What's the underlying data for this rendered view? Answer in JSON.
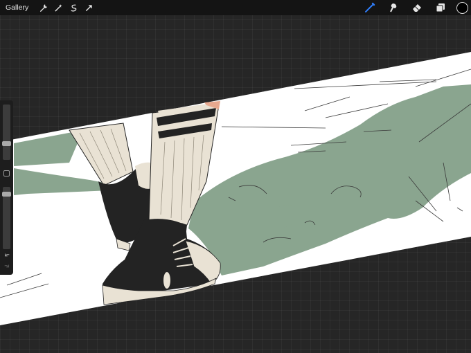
{
  "toolbar": {
    "gallery_label": "Gallery",
    "left_tools": [
      "wrench-icon",
      "magic-wand-icon",
      "selection-icon",
      "transform-arrow-icon"
    ],
    "right_tools": [
      "brush-icon",
      "smudge-icon",
      "eraser-icon",
      "layers-icon"
    ],
    "current_color": "#000000",
    "active_tool_color": "#2f7cf6"
  },
  "sidebar": {
    "brush_size_level": 0.3,
    "opacity_level": 0.05
  },
  "artwork": {
    "background_color": "#ffffff",
    "shadow_color": "#8aa58f",
    "sock_color": "#e9e2d4",
    "shoe_color": "#232323"
  }
}
